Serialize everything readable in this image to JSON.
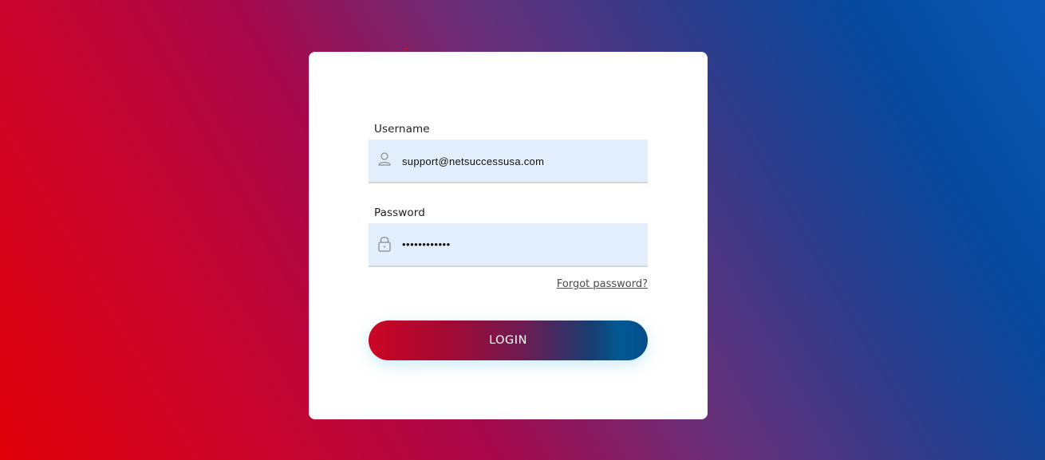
{
  "login_form": {
    "username_label": "Username",
    "username_value": "support@netsuccessusa.com",
    "username_icon": "user-icon",
    "password_label": "Password",
    "password_value": "••••••••••••",
    "password_icon": "lock-icon",
    "forgot_password_link": "Forgot password?",
    "login_button_label": "LOGIN"
  },
  "colors": {
    "background_start": "#e00008",
    "background_end": "#0a58b4",
    "card": "#ffffff",
    "input_background": "#e3eefc",
    "button_gradient_start": "#cc0524",
    "button_gradient_end": "#064c8a"
  }
}
